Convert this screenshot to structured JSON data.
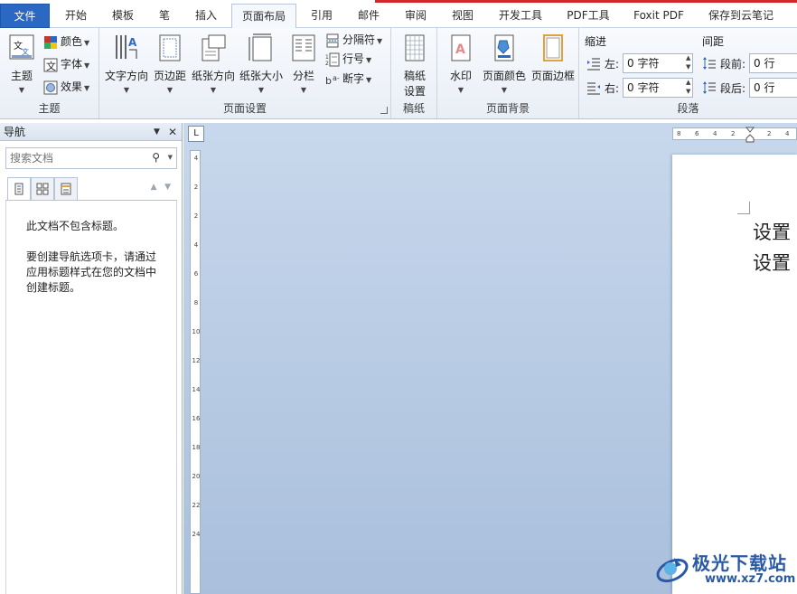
{
  "tabs": [
    {
      "label": "文件",
      "left": 0
    },
    {
      "label": "开始"
    },
    {
      "label": "模板"
    },
    {
      "label": "笔"
    },
    {
      "label": "插入"
    },
    {
      "label": "页面布局"
    },
    {
      "label": "引用"
    },
    {
      "label": "邮件"
    },
    {
      "label": "审阅"
    },
    {
      "label": "视图"
    },
    {
      "label": "开发工具"
    },
    {
      "label": "PDF工具"
    },
    {
      "label": "Foxit PDF"
    },
    {
      "label": "保存到云笔记"
    }
  ],
  "ribbon": {
    "theme_group": {
      "label": "主题",
      "theme_btn": "主题",
      "color_btn": "颜色",
      "font_btn": "字体",
      "effect_btn": "效果"
    },
    "page_setup_group": {
      "label": "页面设置",
      "text_direction": "文字方向",
      "margins": "页边距",
      "orientation": "纸张方向",
      "size": "纸张大小",
      "columns": "分栏",
      "breaks": "分隔符",
      "line_numbers": "行号",
      "hyphenation": "断字"
    },
    "draft_group": {
      "label": "稿纸",
      "draft_settings_line1": "稿纸",
      "draft_settings_line2": "设置"
    },
    "background_group": {
      "label": "页面背景",
      "watermark": "水印",
      "page_color": "页面颜色",
      "page_borders": "页面边框"
    },
    "paragraph_group": {
      "label": "段落",
      "indent_title": "缩进",
      "indent_left_label": "左:",
      "indent_left_value": "0 字符",
      "indent_right_label": "右:",
      "indent_right_value": "0 字符",
      "spacing_title": "间距",
      "spacing_before_label": "段前:",
      "spacing_before_value": "0 行",
      "spacing_after_label": "段后:",
      "spacing_after_value": "0 行"
    }
  },
  "nav_pane": {
    "title": "导航",
    "search_placeholder": "搜索文档",
    "message_line1": "此文档不包含标题。",
    "message_line2": "要创建导航选项卡，请通过",
    "message_line3": "应用标题样式在您的文档中",
    "message_line4": "创建标题。"
  },
  "ruler": {
    "corner": "L",
    "h_ticks": [
      "8",
      "6",
      "4",
      "2",
      "2",
      "4"
    ],
    "v_ticks": [
      "4",
      "2",
      "2",
      "4",
      "6",
      "8",
      "10",
      "12",
      "14",
      "16",
      "18",
      "20",
      "22",
      "24"
    ]
  },
  "document": {
    "line1": "设置",
    "line2": "设置"
  },
  "watermark": {
    "site_name": "极光下载站",
    "site_url": "www.xz7.com"
  },
  "colors": {
    "file_tab": "#2b68c4",
    "accent_red": "#d3282b",
    "doc_bg": "#b8cce6"
  }
}
